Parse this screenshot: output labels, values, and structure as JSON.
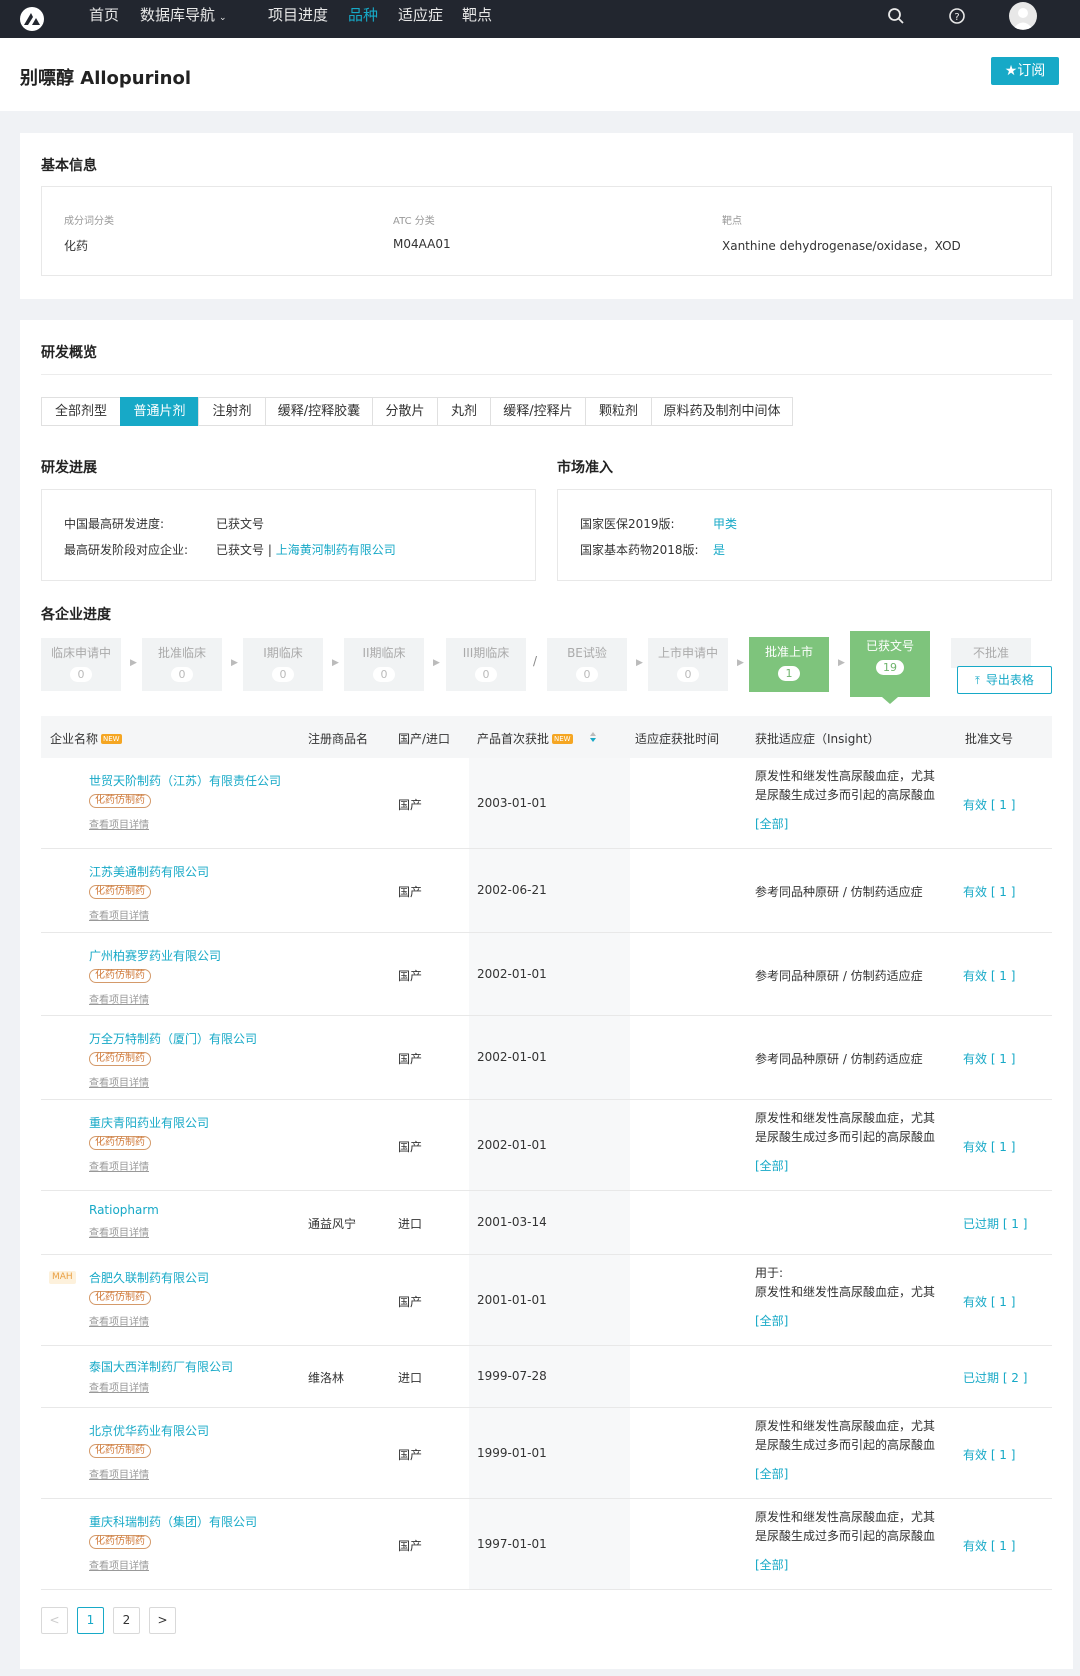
{
  "nav": {
    "items": [
      "首页",
      "数据库导航",
      "项目进度",
      "品种",
      "适应症",
      "靶点"
    ]
  },
  "header": {
    "title": "别嘌醇 Allopurinol",
    "subscribe": "★订阅"
  },
  "basic": {
    "title": "基本信息",
    "fields": [
      {
        "label": "成分词分类",
        "value": "化药"
      },
      {
        "label": "ATC 分类",
        "value": "M04AA01"
      },
      {
        "label": "靶点",
        "value": "Xanthine dehydrogenase/oxidase，XOD"
      }
    ]
  },
  "overview": {
    "title": "研发概览",
    "tabs": [
      "全部剂型",
      "普通片剂",
      "注射剂",
      "缓释/控释胶囊",
      "分散片",
      "丸剂",
      "缓释/控释片",
      "颗粒剂",
      "原料药及制剂中间体"
    ],
    "active_tab": 1,
    "progress": {
      "title": "研发进展",
      "l1": "中国最高研发进度:",
      "v1": "已获文号",
      "l2": "最高研发阶段对应企业:",
      "v2": "已获文号",
      "sep": " | ",
      "v2_link": "上海黄河制药有限公司"
    },
    "market": {
      "title": "市场准入",
      "l1": "国家医保2019版:",
      "v1": "甲类",
      "l2": "国家基本药物2018版:",
      "v2": "是"
    }
  },
  "companies": {
    "title": "各企业进度",
    "stages": [
      {
        "label": "临床申请中",
        "count": "0"
      },
      {
        "label": "批准临床",
        "count": "0"
      },
      {
        "label": "I期临床",
        "count": "0"
      },
      {
        "label": "II期临床",
        "count": "0"
      },
      {
        "label": "III期临床",
        "count": "0"
      },
      {
        "label": "BE试验",
        "count": "0"
      },
      {
        "label": "上市申请中",
        "count": "0"
      },
      {
        "label": "批准上市",
        "count": "1"
      },
      {
        "label": "已获文号",
        "count": "19"
      },
      {
        "label": "不批准",
        "count": ""
      }
    ],
    "slash": "/",
    "export": "导出表格"
  },
  "table": {
    "headers": [
      "企业名称",
      "注册商品名",
      "国产/进口",
      "产品首次获批",
      "适应症获批时间",
      "获批适应症（Insight）",
      "批准文号"
    ],
    "new_badge": "NEW",
    "rows": [
      {
        "company": "世贸天阶制药（江苏）有限责任公司",
        "tag": "化药仿制药",
        "detail": "查看项目详情",
        "mah": "",
        "brand": "",
        "origin": "国产",
        "date": "2003-01-01",
        "indic": "原发性和继发性高尿酸血症，尤其是尿酸生成过多而引起的高尿酸血症",
        "all": "[全部]",
        "approval": "有效 [ 1 ]"
      },
      {
        "company": "江苏美通制药有限公司",
        "tag": "化药仿制药",
        "detail": "查看项目详情",
        "mah": "",
        "brand": "",
        "origin": "国产",
        "date": "2002-06-21",
        "indic": "参考同品种原研 / 仿制药适应症",
        "all": "",
        "approval": "有效 [ 1 ]"
      },
      {
        "company": "广州柏赛罗药业有限公司",
        "tag": "化药仿制药",
        "detail": "查看项目详情",
        "mah": "",
        "brand": "",
        "origin": "国产",
        "date": "2002-01-01",
        "indic": "参考同品种原研 / 仿制药适应症",
        "all": "",
        "approval": "有效 [ 1 ]"
      },
      {
        "company": "万全万特制药（厦门）有限公司",
        "tag": "化药仿制药",
        "detail": "查看项目详情",
        "mah": "",
        "brand": "",
        "origin": "国产",
        "date": "2002-01-01",
        "indic": "参考同品种原研 / 仿制药适应症",
        "all": "",
        "approval": "有效 [ 1 ]"
      },
      {
        "company": "重庆青阳药业有限公司",
        "tag": "化药仿制药",
        "detail": "查看项目详情",
        "mah": "",
        "brand": "",
        "origin": "国产",
        "date": "2002-01-01",
        "indic": "原发性和继发性高尿酸血症，尤其是尿酸生成过多而引起的高尿酸血症",
        "all": "[全部]",
        "approval": "有效 [ 1 ]"
      },
      {
        "company": "Ratiopharm",
        "tag": "",
        "detail": "查看项目详情",
        "mah": "",
        "brand": "通益风宁",
        "origin": "进口",
        "date": "2001-03-14",
        "indic": "",
        "all": "",
        "approval": "已过期 [ 1 ]"
      },
      {
        "company": "合肥久联制药有限公司",
        "tag": "化药仿制药",
        "detail": "查看项目详情",
        "mah": "MAH",
        "brand": "",
        "origin": "国产",
        "date": "2001-01-01",
        "indic": "用于:\n原发性和继发性高尿酸血症，尤其是尿酸生成过多而引起的高尿酸血症",
        "all": "[全部]",
        "approval": "有效 [ 1 ]"
      },
      {
        "company": "泰国大西洋制药厂有限公司",
        "tag": "",
        "detail": "查看项目详情",
        "mah": "",
        "brand": "维洛林",
        "origin": "进口",
        "date": "1999-07-28",
        "indic": "",
        "all": "",
        "approval": "已过期 [ 2 ]"
      },
      {
        "company": "北京优华药业有限公司",
        "tag": "化药仿制药",
        "detail": "查看项目详情",
        "mah": "",
        "brand": "",
        "origin": "国产",
        "date": "1999-01-01",
        "indic": "原发性和继发性高尿酸血症，尤其是尿酸生成过多而引起的高尿酸血症",
        "all": "[全部]",
        "approval": "有效 [ 1 ]"
      },
      {
        "company": "重庆科瑞制药（集团）有限公司",
        "tag": "化药仿制药",
        "detail": "查看项目详情",
        "mah": "",
        "brand": "",
        "origin": "国产",
        "date": "1997-01-01",
        "indic": "原发性和继发性高尿酸血症，尤其是尿酸生成过多而引起的高尿酸血症",
        "all": "[全部]",
        "approval": "有效 [ 1 ]"
      }
    ]
  },
  "pagination": {
    "prev": "<",
    "pages": [
      "1",
      "2"
    ],
    "next": ">",
    "current": "1"
  }
}
